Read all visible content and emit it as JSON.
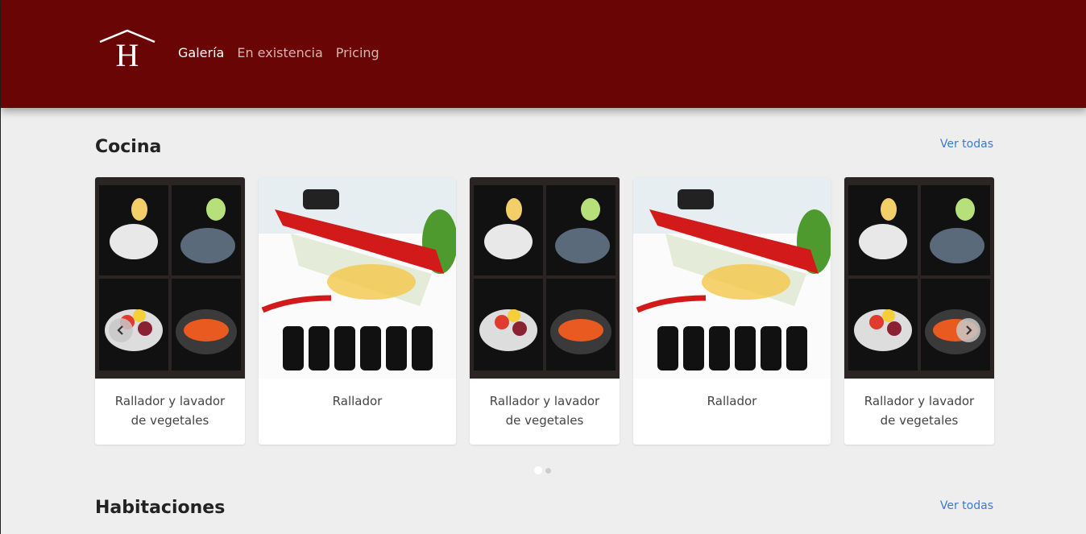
{
  "header": {
    "logo_letter": "H",
    "nav": [
      {
        "label": "Galería",
        "active": true
      },
      {
        "label": "En existencia",
        "active": false
      },
      {
        "label": "Pricing",
        "active": false
      }
    ]
  },
  "sections": [
    {
      "title": "Cocina",
      "see_all": "Ver todas"
    },
    {
      "title": "Habitaciones",
      "see_all": "Ver todas"
    }
  ],
  "cards": [
    {
      "caption": "Rallador y lavador de vegetales",
      "image": "grater-washer-photo"
    },
    {
      "caption": "Rallador",
      "image": "mandoline-slicer-photo"
    },
    {
      "caption": "Rallador y lavador de vegetales",
      "image": "grater-washer-photo"
    },
    {
      "caption": "Rallador",
      "image": "mandoline-slicer-photo"
    },
    {
      "caption": "Rallador y lavador de vegetales",
      "image": "grater-washer-photo"
    }
  ],
  "carousel": {
    "pages": 2,
    "current": 1
  },
  "colors": {
    "header": "#6a0505",
    "link": "#3a78d8",
    "background": "#eeeeee"
  }
}
